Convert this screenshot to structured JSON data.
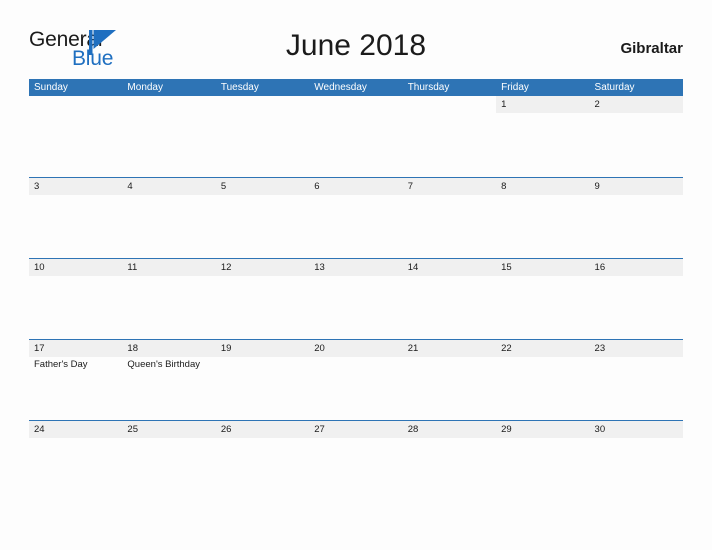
{
  "brand": {
    "name_part1": "General",
    "name_part2": "Blue",
    "flag_icon": "blue-flag-triangle-icon"
  },
  "header": {
    "title": "June 2018",
    "country": "Gibraltar"
  },
  "theme": {
    "header_blue": "#2e74b5",
    "row_divider_blue": "#2e74b5",
    "daynum_band": "#f0f0f0",
    "page_background": "#fdfdfd",
    "text": "#1b1b1b",
    "brand_blue": "#1f6fc0"
  },
  "calendar": {
    "weekday_headers": [
      "Sunday",
      "Monday",
      "Tuesday",
      "Wednesday",
      "Thursday",
      "Friday",
      "Saturday"
    ],
    "weeks": [
      [
        {
          "day": "",
          "events": []
        },
        {
          "day": "",
          "events": []
        },
        {
          "day": "",
          "events": []
        },
        {
          "day": "",
          "events": []
        },
        {
          "day": "",
          "events": []
        },
        {
          "day": "1",
          "events": []
        },
        {
          "day": "2",
          "events": []
        }
      ],
      [
        {
          "day": "3",
          "events": []
        },
        {
          "day": "4",
          "events": []
        },
        {
          "day": "5",
          "events": []
        },
        {
          "day": "6",
          "events": []
        },
        {
          "day": "7",
          "events": []
        },
        {
          "day": "8",
          "events": []
        },
        {
          "day": "9",
          "events": []
        }
      ],
      [
        {
          "day": "10",
          "events": []
        },
        {
          "day": "11",
          "events": []
        },
        {
          "day": "12",
          "events": []
        },
        {
          "day": "13",
          "events": []
        },
        {
          "day": "14",
          "events": []
        },
        {
          "day": "15",
          "events": []
        },
        {
          "day": "16",
          "events": []
        }
      ],
      [
        {
          "day": "17",
          "events": [
            "Father's Day"
          ]
        },
        {
          "day": "18",
          "events": [
            "Queen's Birthday"
          ]
        },
        {
          "day": "19",
          "events": []
        },
        {
          "day": "20",
          "events": []
        },
        {
          "day": "21",
          "events": []
        },
        {
          "day": "22",
          "events": []
        },
        {
          "day": "23",
          "events": []
        }
      ],
      [
        {
          "day": "24",
          "events": []
        },
        {
          "day": "25",
          "events": []
        },
        {
          "day": "26",
          "events": []
        },
        {
          "day": "27",
          "events": []
        },
        {
          "day": "28",
          "events": []
        },
        {
          "day": "29",
          "events": []
        },
        {
          "day": "30",
          "events": []
        }
      ]
    ]
  }
}
